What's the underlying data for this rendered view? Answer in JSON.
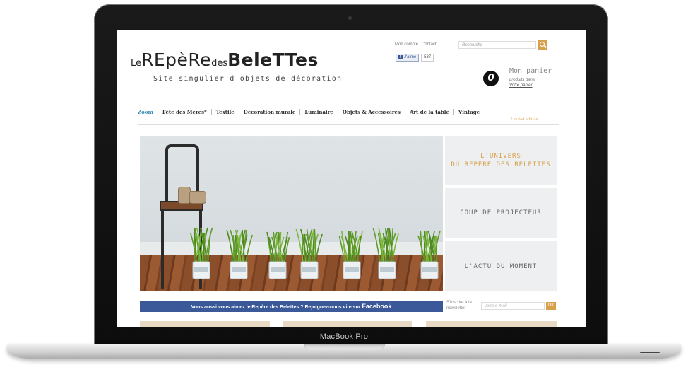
{
  "device": {
    "label": "MacBook Pro"
  },
  "site": {
    "logo": {
      "p1": "Le",
      "p2": "REpèRe",
      "p3": "des",
      "p4": "BeleTTes"
    },
    "tagline": "Site singulier d'objets de décoration",
    "account": {
      "my_account": "Mon compte",
      "sep": "|",
      "contact": "Contact"
    },
    "facebook_like": {
      "label": "J'aime",
      "count": "537"
    },
    "search": {
      "placeholder": "Recherche"
    },
    "cart": {
      "count": "0",
      "title": "Mon panier",
      "subtitle": "produits dans",
      "link": "Votre panier"
    },
    "nav": {
      "items": [
        "Zoom",
        "Fête des Mères*",
        "Textile",
        "Décoration murale",
        "Luminaire",
        "Objets & Accessoires",
        "Art de la table",
        "Vintage"
      ],
      "vintage_sub": "Limited edition"
    },
    "tiles": {
      "t1_line1": "L'UNIVERS",
      "t1_line2": "DU REPÈRE DES BELETTES",
      "t2": "COUP DE PROJECTEUR",
      "t3": "L'ACTU DU MOMENT"
    },
    "facebook_bar": {
      "text": "Vous aussi vous aimez le Repère des Belettes ? Rejoignez-nous vite sur ",
      "strong": "Facebook"
    },
    "newsletter": {
      "label": "S'inscrire à la newsletter",
      "placeholder": "votre e-mail",
      "button": "OK"
    }
  },
  "colors": {
    "accent": "#d8a04a",
    "facebook": "#3b5998",
    "nav_active": "#3a8ab8"
  }
}
